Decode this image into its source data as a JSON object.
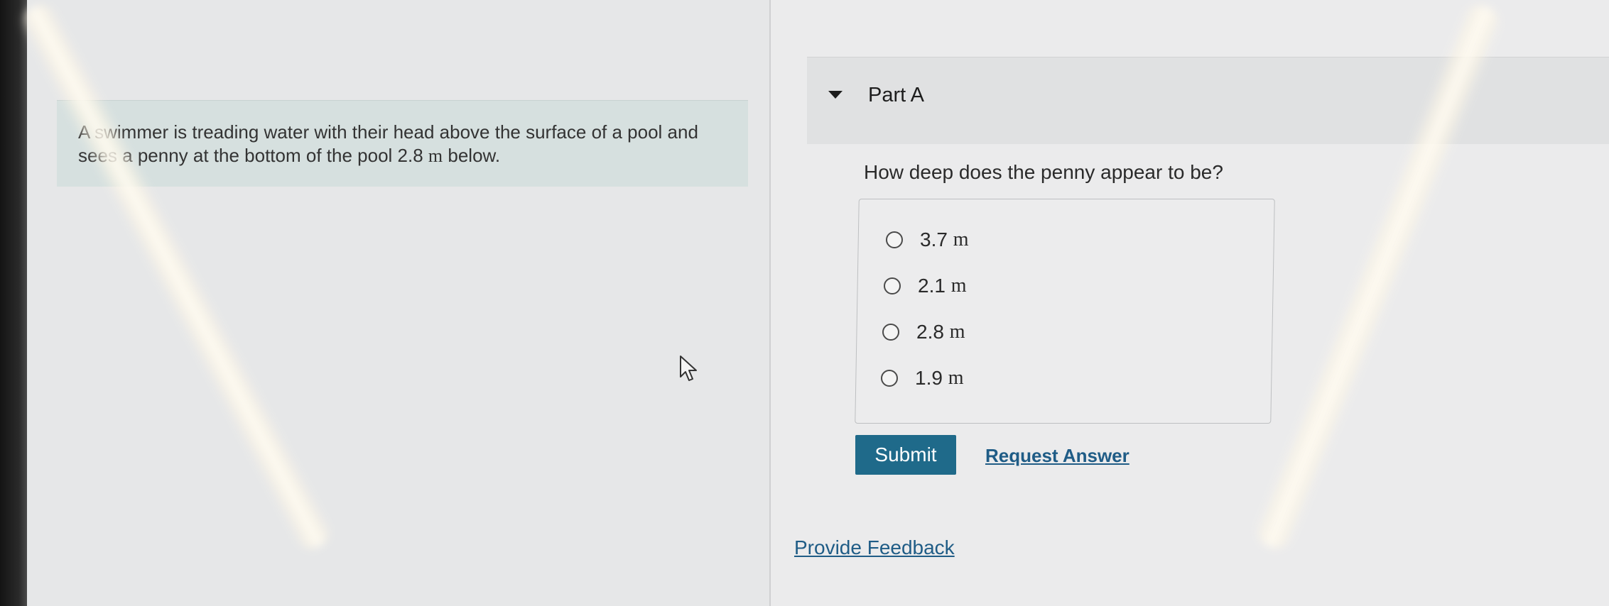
{
  "problem": {
    "text_before": "A swimmer is treading water with their head above the surface of a pool and sees a penny at the bottom of the pool ",
    "value": "2.8",
    "unit": "m",
    "text_after": " below."
  },
  "part": {
    "title": "Part A",
    "question": "How deep does the penny appear to be?",
    "choices": [
      {
        "value": "3.7",
        "unit": "m"
      },
      {
        "value": "2.1",
        "unit": "m"
      },
      {
        "value": "2.8",
        "unit": "m"
      },
      {
        "value": "1.9",
        "unit": "m"
      }
    ],
    "submit_label": "Submit",
    "request_answer_label": "Request Answer"
  },
  "footer": {
    "feedback_label": "Provide Feedback"
  },
  "icons": {
    "collapse": "caret-down-icon",
    "pointer": "mouse-pointer-icon"
  },
  "colors": {
    "submit_bg": "#1f6a8a",
    "link": "#1f5c86",
    "problem_bg": "#d6e0df"
  }
}
